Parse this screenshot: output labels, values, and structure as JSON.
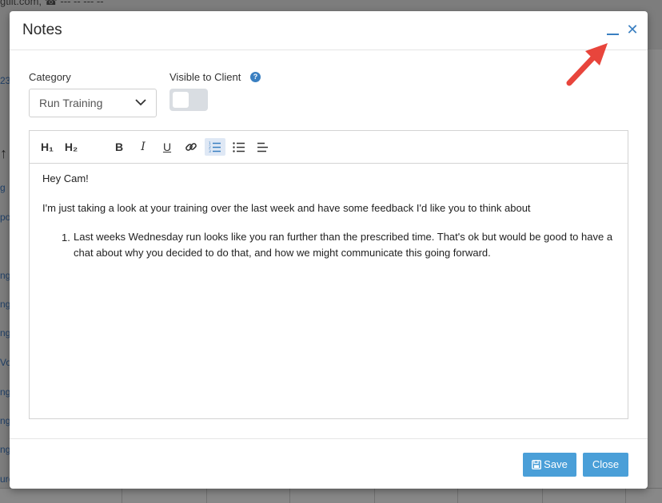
{
  "background": {
    "top_text": "gtiit.com, ☎ --- -- --- --",
    "left_fragments": [
      {
        "text": "23",
        "y": 0
      },
      {
        "text": "↑",
        "y": 0
      },
      {
        "text": "g",
        "y": 0
      },
      {
        "text": "po",
        "y": 0
      },
      {
        "text": "ng",
        "y": 0
      },
      {
        "text": "ng",
        "y": 0
      },
      {
        "text": "ng",
        "y": 0
      },
      {
        "text": "Vo",
        "y": 0
      },
      {
        "text": "ng",
        "y": 0
      },
      {
        "text": "ng",
        "y": 0
      },
      {
        "text": "ng",
        "y": 0
      },
      {
        "text": "ure",
        "y": 0
      }
    ]
  },
  "modal": {
    "title": "Notes",
    "minimize_icon": "minimize-icon",
    "close_icon": "close-icon"
  },
  "form": {
    "category_label": "Category",
    "category_value": "Run Training",
    "visible_label": "Visible to Client",
    "help_icon_glyph": "?",
    "visible_on": false
  },
  "toolbar": {
    "h1": "H₁",
    "h2": "H₂",
    "bold": "B",
    "italic": "I",
    "underline": "U"
  },
  "note": {
    "greeting": "Hey Cam!",
    "intro": "I'm just taking a look at your training over the last week and have some feedback I'd like you to think about",
    "list": [
      {
        "number": "1.",
        "text": "Last weeks Wednesday run looks like you ran further than the prescribed time. That's ok but would be good to have a chat about why you decided to do that, and how we might communicate this going forward."
      }
    ]
  },
  "footer": {
    "save_label": "Save",
    "close_label": "Close"
  },
  "colors": {
    "accent": "#3a7fc1",
    "button": "#4a9fd8",
    "arrow": "#e8453c"
  }
}
